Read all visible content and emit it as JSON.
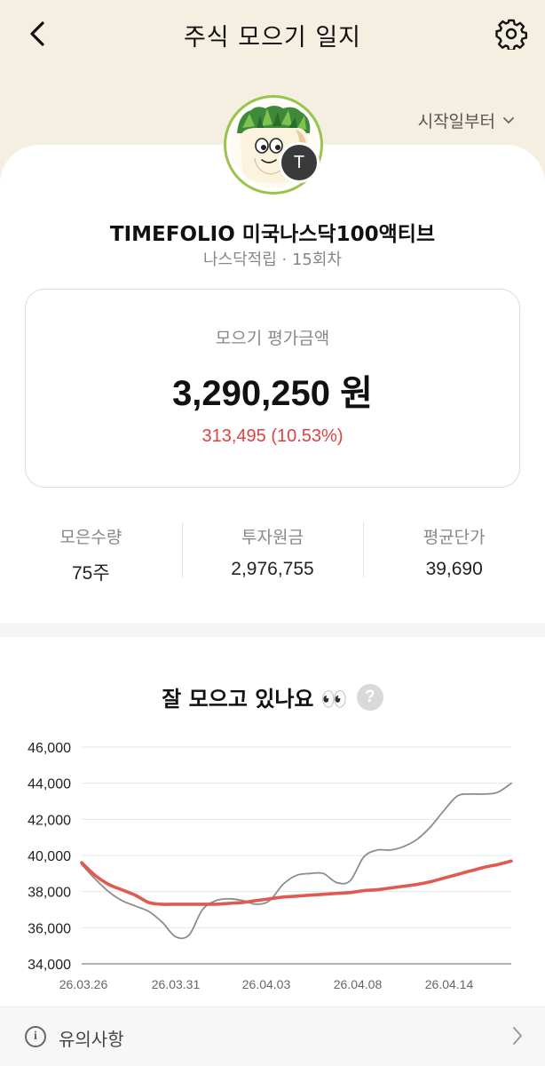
{
  "header": {
    "title": "주식 모으기 일지",
    "start_filter_label": "시작일부터"
  },
  "profile": {
    "badge_letter": "T",
    "fund_name": "TIMEFOLIO 미국나스닥100액티브",
    "subtitle": "나스닥적립 · 15회차"
  },
  "valuation": {
    "label": "모으기 평가금액",
    "amount": "3,290,250 원",
    "change": "313,495 (10.53%)",
    "change_color": "#e0413f"
  },
  "stats": [
    {
      "label": "모은수량",
      "value": "75주"
    },
    {
      "label": "투자원금",
      "value": "2,976,755"
    },
    {
      "label": "평균단가",
      "value": "39,690"
    }
  ],
  "chart_section": {
    "title": "잘 모으고 있나요 👀",
    "help_symbol": "?"
  },
  "chart_data": {
    "type": "line",
    "y_ticks": [
      "46,000",
      "44,000",
      "42,000",
      "40,000",
      "38,000",
      "36,000",
      "34,000"
    ],
    "ylim": [
      34000,
      46000
    ],
    "x_tick_labels": [
      "26.03.26",
      "26.03.31",
      "26.04.03",
      "26.04.08",
      "26.04.14"
    ],
    "series": [
      {
        "name": "price",
        "color": "#8c8c8c",
        "values": [
          39500,
          38700,
          38000,
          37500,
          37200,
          36900,
          36300,
          35500,
          35600,
          37000,
          37500,
          37600,
          37500,
          37300,
          37500,
          38400,
          38900,
          39000,
          39000,
          38500,
          38600,
          39900,
          40300,
          40300,
          40500,
          40900,
          41600,
          42500,
          43300,
          43400,
          43400,
          43500,
          44000
        ]
      },
      {
        "name": "average",
        "color": "#e05a50",
        "values": [
          39600,
          38900,
          38400,
          38100,
          37800,
          37400,
          37300,
          37300,
          37300,
          37300,
          37300,
          37350,
          37400,
          37500,
          37600,
          37700,
          37750,
          37800,
          37850,
          37900,
          37950,
          38050,
          38100,
          38200,
          38300,
          38400,
          38550,
          38750,
          38950,
          39150,
          39350,
          39500,
          39690
        ]
      }
    ]
  },
  "footer": {
    "info_symbol": "i",
    "label": "유의사항"
  },
  "icons": {
    "back": "chevron-left-icon",
    "settings": "gear-icon",
    "dropdown": "chevron-down-icon",
    "footer_arrow": "chevron-right-icon"
  }
}
